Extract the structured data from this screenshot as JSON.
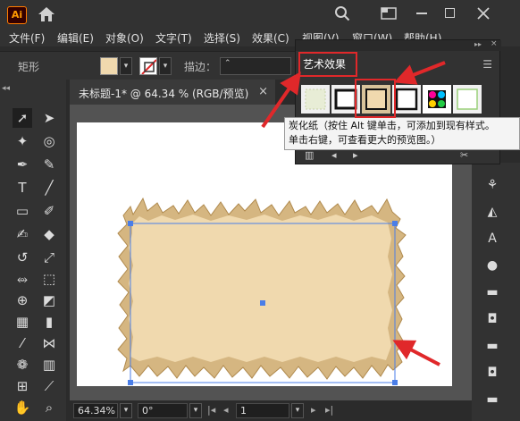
{
  "app": {
    "logo": "Ai"
  },
  "menubar": {
    "items": [
      "文件(F)",
      "编辑(E)",
      "对象(O)",
      "文字(T)",
      "选择(S)",
      "效果(C)",
      "视图(V)",
      "窗口(W)",
      "帮助(H)"
    ]
  },
  "controlbar": {
    "object_type": "矩形",
    "stroke_label": "描边："
  },
  "document": {
    "tab_title": "未标题-1* @ 64.34 % (RGB/预览)",
    "close_glyph": "×"
  },
  "graphic_styles_panel": {
    "title": "艺术效果",
    "tooltip": {
      "line1": "炭化纸（按住 Alt 键单击，可添加到现有样式。",
      "line2": "单击右键，可查看更大的预览图。）"
    },
    "thumbnails": [
      "ink-wash-style",
      "black-brush-frame-style",
      "charcoal-paper-style",
      "dark-frame-style",
      "colorful-dots-style",
      "green-edge-style"
    ],
    "selected_thumbnail": "charcoal-paper-style"
  },
  "statusbar": {
    "zoom": "64.34%",
    "rotation": "0°",
    "artboard_number": "1"
  },
  "colors": {
    "fill": "#f0d9ae",
    "paper_edge": "#c9a46c",
    "selection": "#4a7ee8",
    "annotation": "#e0282a"
  }
}
